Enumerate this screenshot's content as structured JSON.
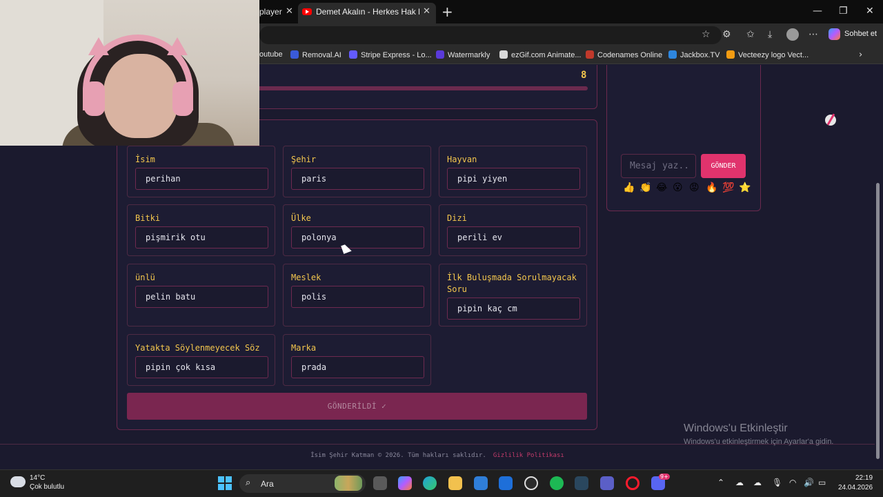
{
  "browser": {
    "tabs": [
      {
        "label": "player",
        "partial": true
      },
      {
        "label": "Demet Akalın - Herkes Hak Ettiği Gibi",
        "active": true
      }
    ],
    "profile_button": "Sohbet et",
    "bookmarks": [
      {
        "label": "outube",
        "color": "#ff3b30"
      },
      {
        "label": "Removal.AI",
        "color": "#3a5bd9"
      },
      {
        "label": "Stripe Express - Lo...",
        "color": "#635bff"
      },
      {
        "label": "Watermarkly",
        "color": "#5a3ad9"
      },
      {
        "label": "ezGif.com Animate...",
        "color": "#d9d9d9"
      },
      {
        "label": "Codenames Online",
        "color": "#c0392b"
      },
      {
        "label": "Jackbox.TV",
        "color": "#2e86de"
      },
      {
        "label": "Vecteezy logo Vect...",
        "color": "#f39c12"
      }
    ]
  },
  "game": {
    "round_timer": "8",
    "categories": [
      {
        "label": "İsim",
        "value": "perihan"
      },
      {
        "label": "Şehir",
        "value": "paris"
      },
      {
        "label": "Hayvan",
        "value": "pipi yiyen"
      },
      {
        "label": "Bitki",
        "value": "pişmirik otu"
      },
      {
        "label": "Ülke",
        "value": "polonya"
      },
      {
        "label": "Dizi",
        "value": "perili ev"
      },
      {
        "label": "ünlü",
        "value": "pelin batu"
      },
      {
        "label": "Meslek",
        "value": "polis"
      },
      {
        "label": "İlk Buluşmada Sorulmayacak Soru",
        "value": "pipin kaç cm"
      },
      {
        "label": "Yatakta Söylenmeyecek Söz",
        "value": "pipin çok kısa"
      },
      {
        "label": "Marka",
        "value": "prada"
      }
    ],
    "submit_label": "GÖNDERİLDİ ✓"
  },
  "chat": {
    "placeholder": "Mesaj yaz..",
    "send_label": "GÖNDER",
    "emojis": [
      "👍",
      "👏",
      "😂",
      "😮",
      "😡",
      "🔥",
      "💯",
      "⭐"
    ]
  },
  "footer": {
    "copyright": "İsim Şehir Katman © 2026. Tüm hakları saklıdır.",
    "privacy_link": "Gizlilik Politikası"
  },
  "windows_activation": {
    "title": "Windows'u Etkinleştir",
    "subtitle": "Windows'u etkinleştirmek için Ayarlar'a gidin."
  },
  "taskbar": {
    "temperature": "14°C",
    "weather": "Çok bulutlu",
    "search_label": "Ara",
    "time": "22:19",
    "date": "24.04.2026",
    "notification_badge": "9+"
  },
  "colors": {
    "accent": "#e0336d",
    "label_yellow": "#f3c64d",
    "background": "#1b1a2e",
    "border": "#6b2a4e"
  }
}
